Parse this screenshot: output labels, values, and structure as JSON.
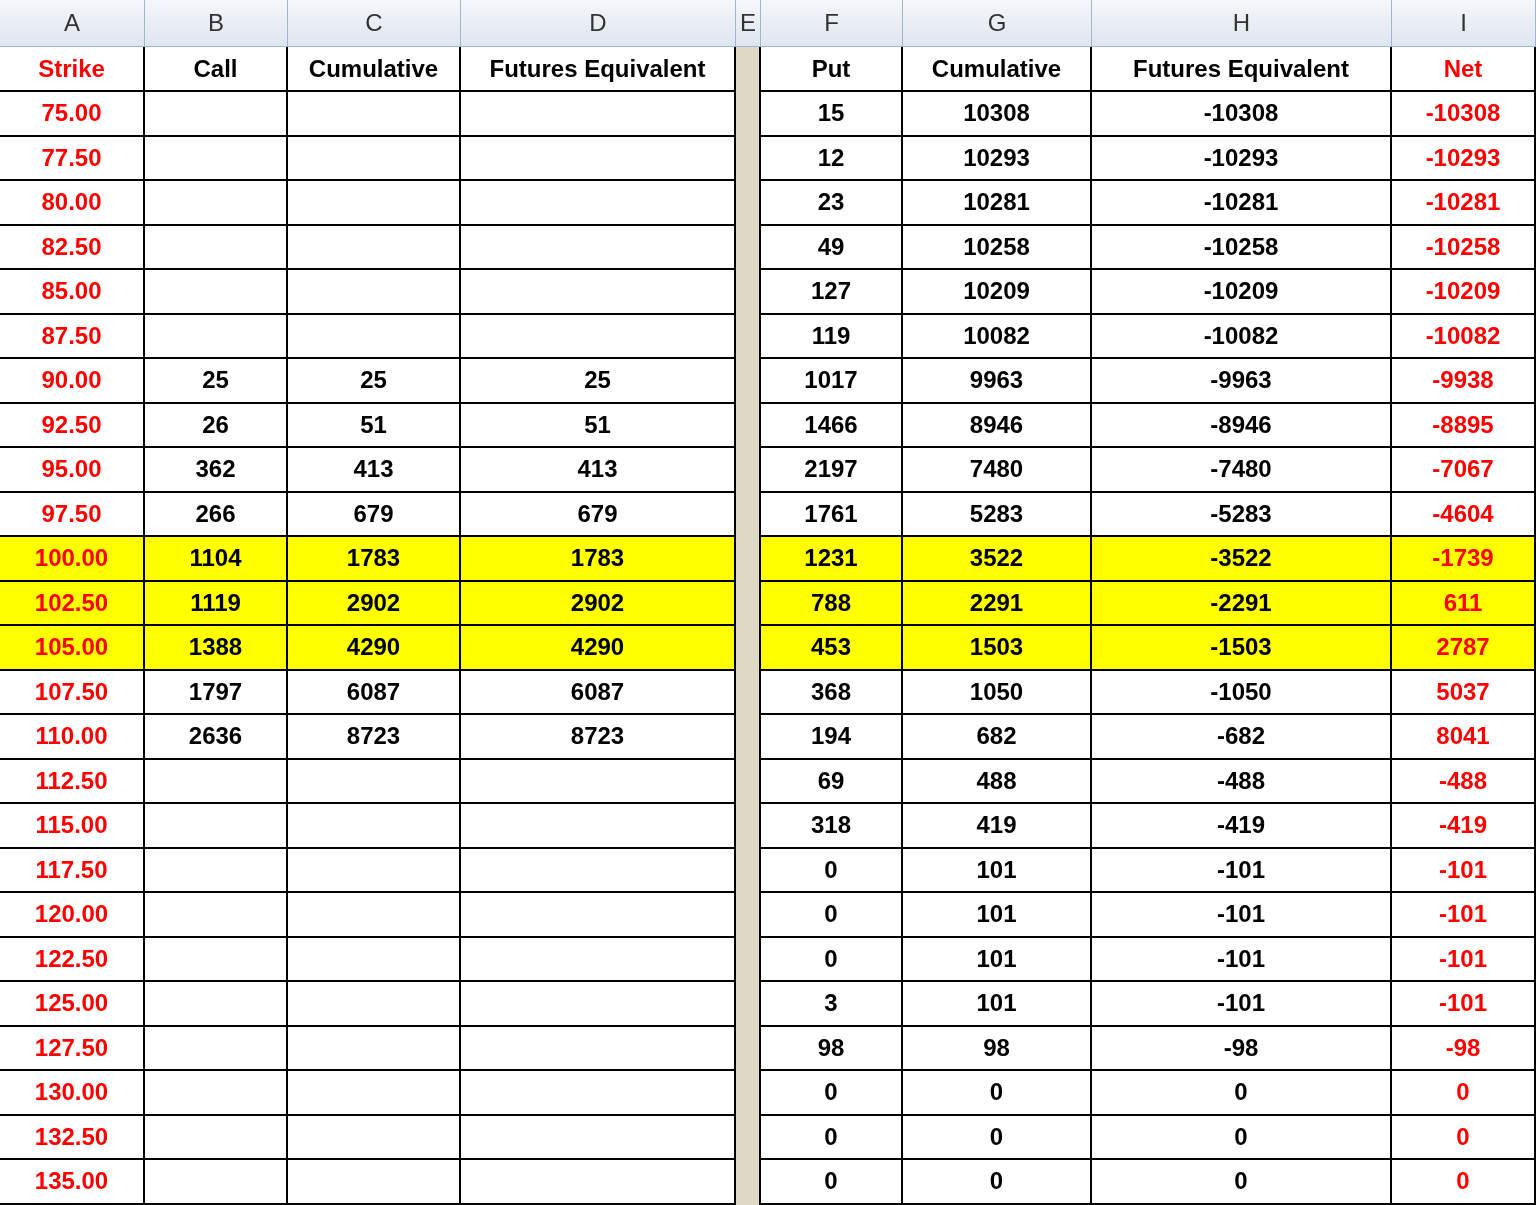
{
  "columns": [
    {
      "letter": "A",
      "header": "Strike",
      "color": "#ff0000",
      "kind": "data"
    },
    {
      "letter": "B",
      "header": "Call",
      "color": "#000000",
      "kind": "data"
    },
    {
      "letter": "C",
      "header": "Cumulative",
      "color": "#000000",
      "kind": "data"
    },
    {
      "letter": "D",
      "header": "Futures Equivalent",
      "color": "#000000",
      "kind": "data"
    },
    {
      "letter": "E",
      "kind": "spacer"
    },
    {
      "letter": "F",
      "header": "Put",
      "color": "#000000",
      "kind": "data"
    },
    {
      "letter": "G",
      "header": "Cumulative",
      "color": "#000000",
      "kind": "data"
    },
    {
      "letter": "H",
      "header": "Futures Equivalent",
      "color": "#000000",
      "kind": "data"
    },
    {
      "letter": "I",
      "header": "Net",
      "color": "#ff0000",
      "kind": "data"
    }
  ],
  "rows": [
    {
      "highlighted": false,
      "cells": [
        "75.00",
        null,
        null,
        null,
        null,
        "15",
        "10308",
        "-10308",
        "-10308"
      ]
    },
    {
      "highlighted": false,
      "cells": [
        "77.50",
        null,
        null,
        null,
        null,
        "12",
        "10293",
        "-10293",
        "-10293"
      ]
    },
    {
      "highlighted": false,
      "cells": [
        "80.00",
        null,
        null,
        null,
        null,
        "23",
        "10281",
        "-10281",
        "-10281"
      ]
    },
    {
      "highlighted": false,
      "cells": [
        "82.50",
        null,
        null,
        null,
        null,
        "49",
        "10258",
        "-10258",
        "-10258"
      ]
    },
    {
      "highlighted": false,
      "cells": [
        "85.00",
        null,
        null,
        null,
        null,
        "127",
        "10209",
        "-10209",
        "-10209"
      ]
    },
    {
      "highlighted": false,
      "cells": [
        "87.50",
        null,
        null,
        null,
        null,
        "119",
        "10082",
        "-10082",
        "-10082"
      ]
    },
    {
      "highlighted": false,
      "cells": [
        "90.00",
        "25",
        "25",
        "25",
        null,
        "1017",
        "9963",
        "-9963",
        "-9938"
      ]
    },
    {
      "highlighted": false,
      "cells": [
        "92.50",
        "26",
        "51",
        "51",
        null,
        "1466",
        "8946",
        "-8946",
        "-8895"
      ]
    },
    {
      "highlighted": false,
      "cells": [
        "95.00",
        "362",
        "413",
        "413",
        null,
        "2197",
        "7480",
        "-7480",
        "-7067"
      ]
    },
    {
      "highlighted": false,
      "cells": [
        "97.50",
        "266",
        "679",
        "679",
        null,
        "1761",
        "5283",
        "-5283",
        "-4604"
      ]
    },
    {
      "highlighted": true,
      "cells": [
        "100.00",
        "1104",
        "1783",
        "1783",
        null,
        "1231",
        "3522",
        "-3522",
        "-1739"
      ]
    },
    {
      "highlighted": true,
      "cells": [
        "102.50",
        "1119",
        "2902",
        "2902",
        null,
        "788",
        "2291",
        "-2291",
        "611"
      ]
    },
    {
      "highlighted": true,
      "cells": [
        "105.00",
        "1388",
        "4290",
        "4290",
        null,
        "453",
        "1503",
        "-1503",
        "2787"
      ]
    },
    {
      "highlighted": false,
      "cells": [
        "107.50",
        "1797",
        "6087",
        "6087",
        null,
        "368",
        "1050",
        "-1050",
        "5037"
      ]
    },
    {
      "highlighted": false,
      "cells": [
        "110.00",
        "2636",
        "8723",
        "8723",
        null,
        "194",
        "682",
        "-682",
        "8041"
      ]
    },
    {
      "highlighted": false,
      "cells": [
        "112.50",
        null,
        null,
        null,
        null,
        "69",
        "488",
        "-488",
        "-488"
      ]
    },
    {
      "highlighted": false,
      "cells": [
        "115.00",
        null,
        null,
        null,
        null,
        "318",
        "419",
        "-419",
        "-419"
      ]
    },
    {
      "highlighted": false,
      "cells": [
        "117.50",
        null,
        null,
        null,
        null,
        "0",
        "101",
        "-101",
        "-101"
      ]
    },
    {
      "highlighted": false,
      "cells": [
        "120.00",
        null,
        null,
        null,
        null,
        "0",
        "101",
        "-101",
        "-101"
      ]
    },
    {
      "highlighted": false,
      "cells": [
        "122.50",
        null,
        null,
        null,
        null,
        "0",
        "101",
        "-101",
        "-101"
      ]
    },
    {
      "highlighted": false,
      "cells": [
        "125.00",
        null,
        null,
        null,
        null,
        "3",
        "101",
        "-101",
        "-101"
      ]
    },
    {
      "highlighted": false,
      "cells": [
        "127.50",
        null,
        null,
        null,
        null,
        "98",
        "98",
        "-98",
        "-98"
      ]
    },
    {
      "highlighted": false,
      "cells": [
        "130.00",
        null,
        null,
        null,
        null,
        "0",
        "0",
        "0",
        "0"
      ]
    },
    {
      "highlighted": false,
      "cells": [
        "132.50",
        null,
        null,
        null,
        null,
        "0",
        "0",
        "0",
        "0"
      ]
    },
    {
      "highlighted": false,
      "cells": [
        "135.00",
        null,
        null,
        null,
        null,
        "0",
        "0",
        "0",
        "0"
      ]
    }
  ]
}
